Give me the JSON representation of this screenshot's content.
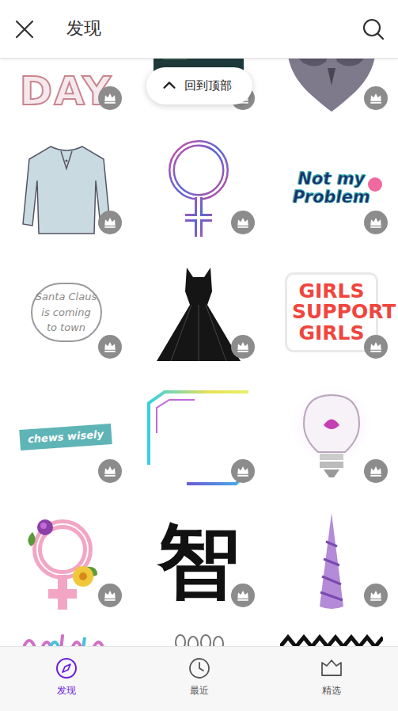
{
  "header": {
    "title": "发现"
  },
  "back_to_top": {
    "label": "回到顶部"
  },
  "stickers": [
    {
      "kind": "lettering",
      "text": "DAY",
      "premium": true
    },
    {
      "kind": "photo",
      "premium": true
    },
    {
      "kind": "owl",
      "premium": true
    },
    {
      "kind": "shirt",
      "premium": true
    },
    {
      "kind": "venus",
      "premium": true
    },
    {
      "kind": "badge",
      "text": "Not my Problem",
      "premium": true
    },
    {
      "kind": "santa",
      "text": "Santa Claus is coming to town",
      "premium": true
    },
    {
      "kind": "dress",
      "premium": true
    },
    {
      "kind": "block",
      "text": "GIRLS SUPPORT GIRLS",
      "premium": true
    },
    {
      "kind": "ribbon",
      "text": "chews wisely",
      "premium": true
    },
    {
      "kind": "frame",
      "premium": true
    },
    {
      "kind": "bulb",
      "premium": true
    },
    {
      "kind": "flowers",
      "premium": true
    },
    {
      "kind": "brush",
      "text": "智",
      "premium": true
    },
    {
      "kind": "horn",
      "premium": true
    },
    {
      "kind": "strokes",
      "premium": true
    },
    {
      "kind": "feet",
      "premium": true
    },
    {
      "kind": "zigzag",
      "premium": true
    }
  ],
  "tabs": [
    {
      "label": "发现",
      "selected": true
    },
    {
      "label": "最近",
      "selected": false
    },
    {
      "label": "精选",
      "selected": false
    }
  ]
}
